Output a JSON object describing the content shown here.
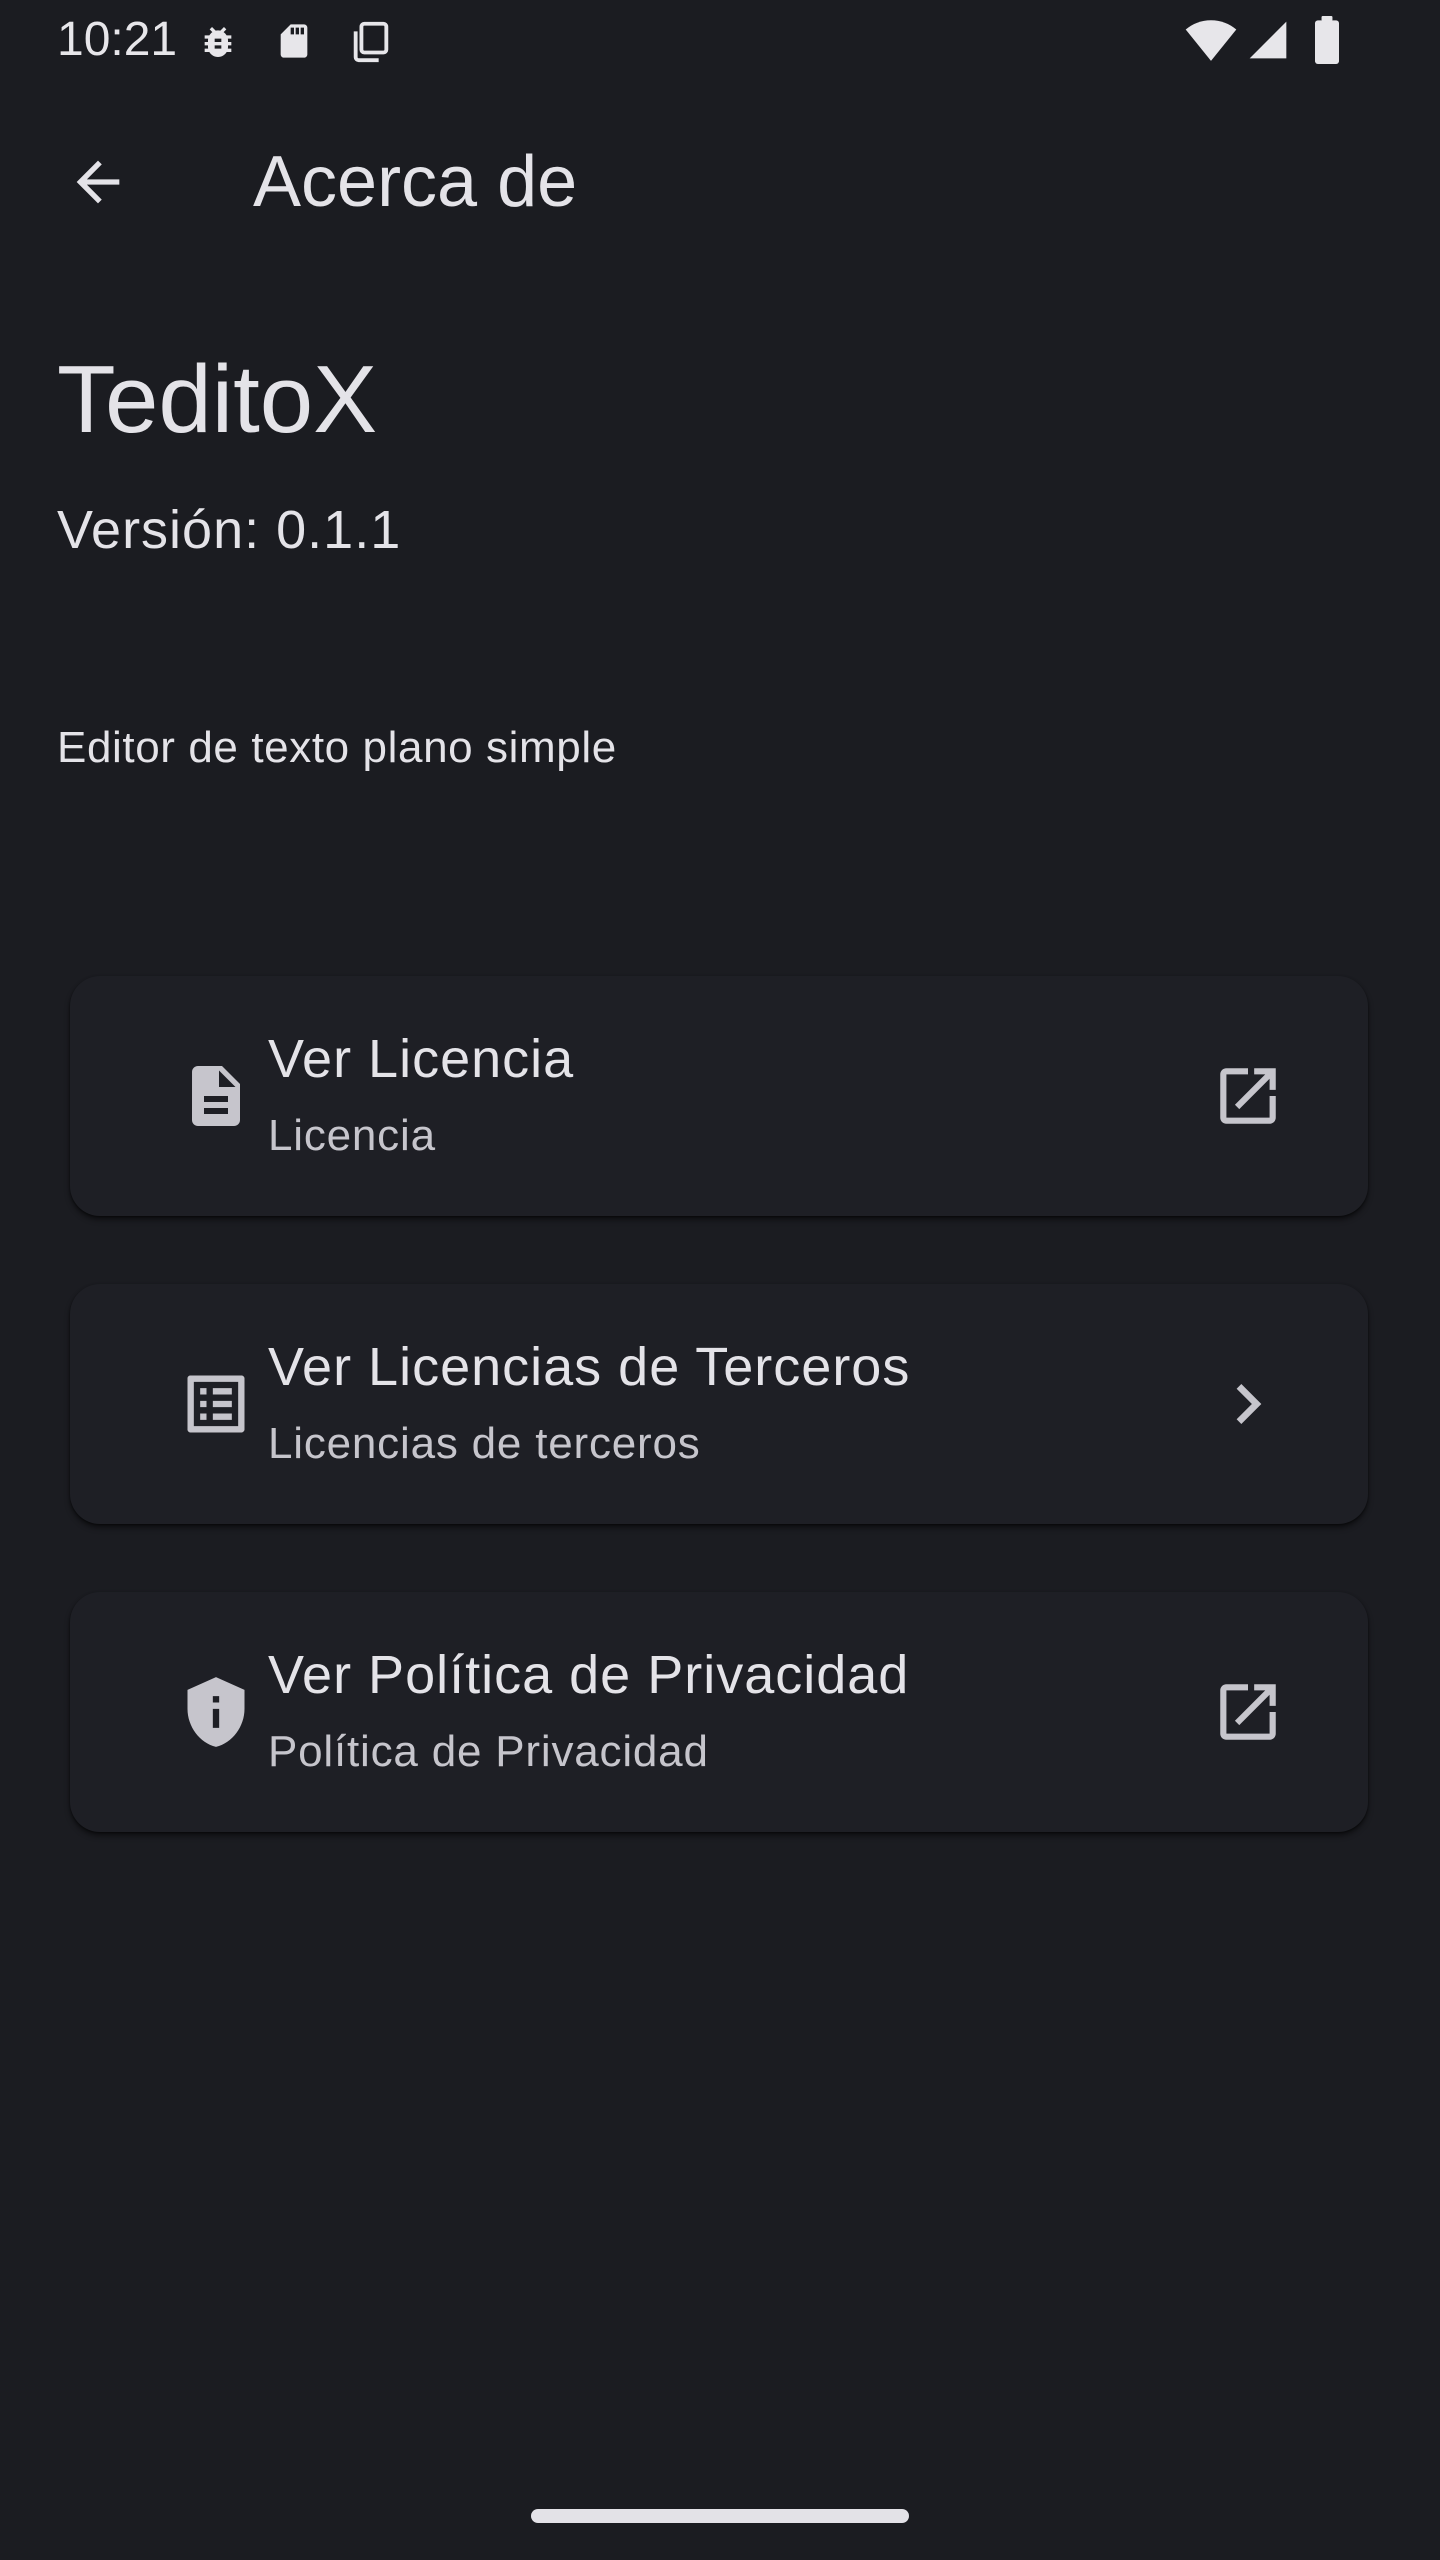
{
  "status_bar": {
    "time": "10:21",
    "icons": [
      "bug-icon",
      "sd-card-icon",
      "copy-icon",
      "wifi-icon",
      "signal-icon",
      "battery-icon"
    ]
  },
  "app_bar": {
    "title": "Acerca de",
    "back_icon": "arrow-back-icon"
  },
  "about": {
    "app_name": "TeditoX",
    "version": "Versión: 0.1.1",
    "description": "Editor de texto plano simple"
  },
  "items": [
    {
      "title": "Ver Licencia",
      "subtitle": "Licencia",
      "leading_icon": "document-icon",
      "trailing_icon": "open-in-new-icon"
    },
    {
      "title": "Ver Licencias de Terceros",
      "subtitle": "Licencias de terceros",
      "leading_icon": "list-icon",
      "trailing_icon": "chevron-right-icon"
    },
    {
      "title": "Ver Política de Privacidad",
      "subtitle": "Política de Privacidad",
      "leading_icon": "shield-info-icon",
      "trailing_icon": "open-in-new-icon"
    }
  ],
  "colors": {
    "background": "#1b1c21",
    "card": "#1e1f25",
    "text_primary": "#e4e3e8",
    "text_secondary": "#c6c5cc"
  }
}
